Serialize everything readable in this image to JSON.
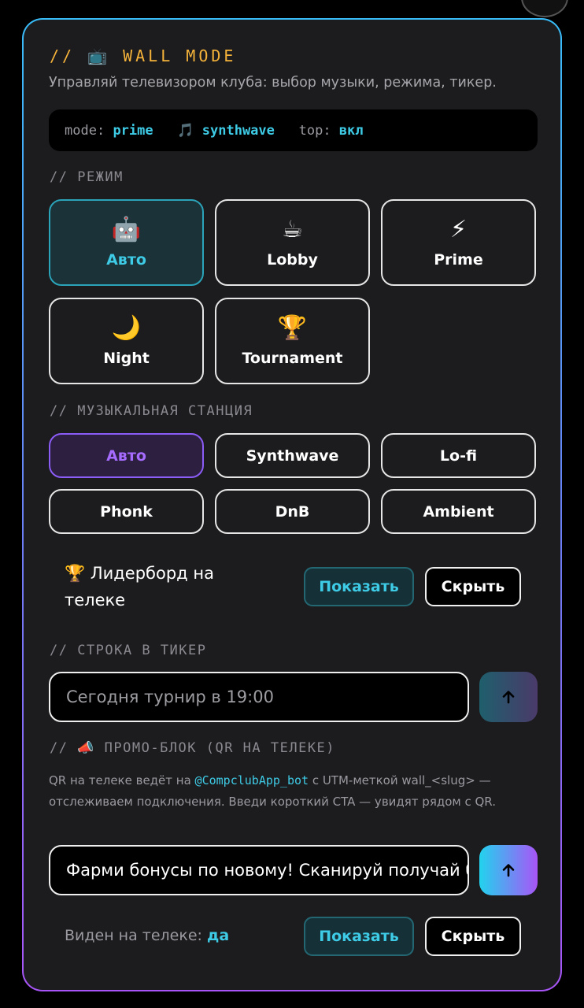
{
  "title": "// 📺 WALL MODE",
  "subtitle": "Управляй телевизором клуба: выбор музыки, режима, тикер.",
  "status": {
    "mode_key": "mode:",
    "mode_value": "prime",
    "music_icon": "🎵",
    "music_value": "synthwave",
    "top_key": "top:",
    "top_value": "вкл"
  },
  "mode_section": {
    "heading": "// РЕЖИМ",
    "items": [
      {
        "icon": "🤖",
        "label": "Авто",
        "active": true
      },
      {
        "icon": "☕",
        "label": "Lobby"
      },
      {
        "icon": "⚡",
        "label": "Prime"
      },
      {
        "icon": "🌙",
        "label": "Night"
      },
      {
        "icon": "🏆",
        "label": "Tournament"
      }
    ]
  },
  "music_section": {
    "heading": "// МУЗЫКАЛЬНАЯ СТАНЦИЯ",
    "items": [
      {
        "label": "Авто",
        "active": true
      },
      {
        "label": "Synthwave"
      },
      {
        "label": "Lo-fi"
      },
      {
        "label": "Phonk"
      },
      {
        "label": "DnB"
      },
      {
        "label": "Ambient"
      }
    ]
  },
  "leaderboard": {
    "icon": "🏆",
    "label": "Лидерборд на телеке",
    "show_label": "Показать",
    "hide_label": "Скрыть"
  },
  "ticker": {
    "heading": "// СТРОКА В ТИКЕР",
    "value": "Сегодня турнир в 19:00"
  },
  "promo": {
    "heading_prefix": "//",
    "heading_icon": "📣",
    "heading_text": "ПРОМО-БЛОК (QR НА ТЕЛЕКЕ)",
    "desc_part1": "QR на телеке ведёт на ",
    "desc_link": "@CompclubApp_bot",
    "desc_part2": " с UTM-меткой wall_<slug> — отслеживаем подключения. Введи короткий CTA — увидят рядом с QR.",
    "value": "Фарми бонусы по новому!  Сканируй получай бонусы",
    "visible_label": "Виден на телеке:",
    "visible_value": "да",
    "show_label": "Показать",
    "hide_label": "Скрыть"
  },
  "colors": {
    "accent_cyan": "#3ecbe6",
    "accent_purple": "#a66bff",
    "title_amber": "#f5b33a"
  }
}
